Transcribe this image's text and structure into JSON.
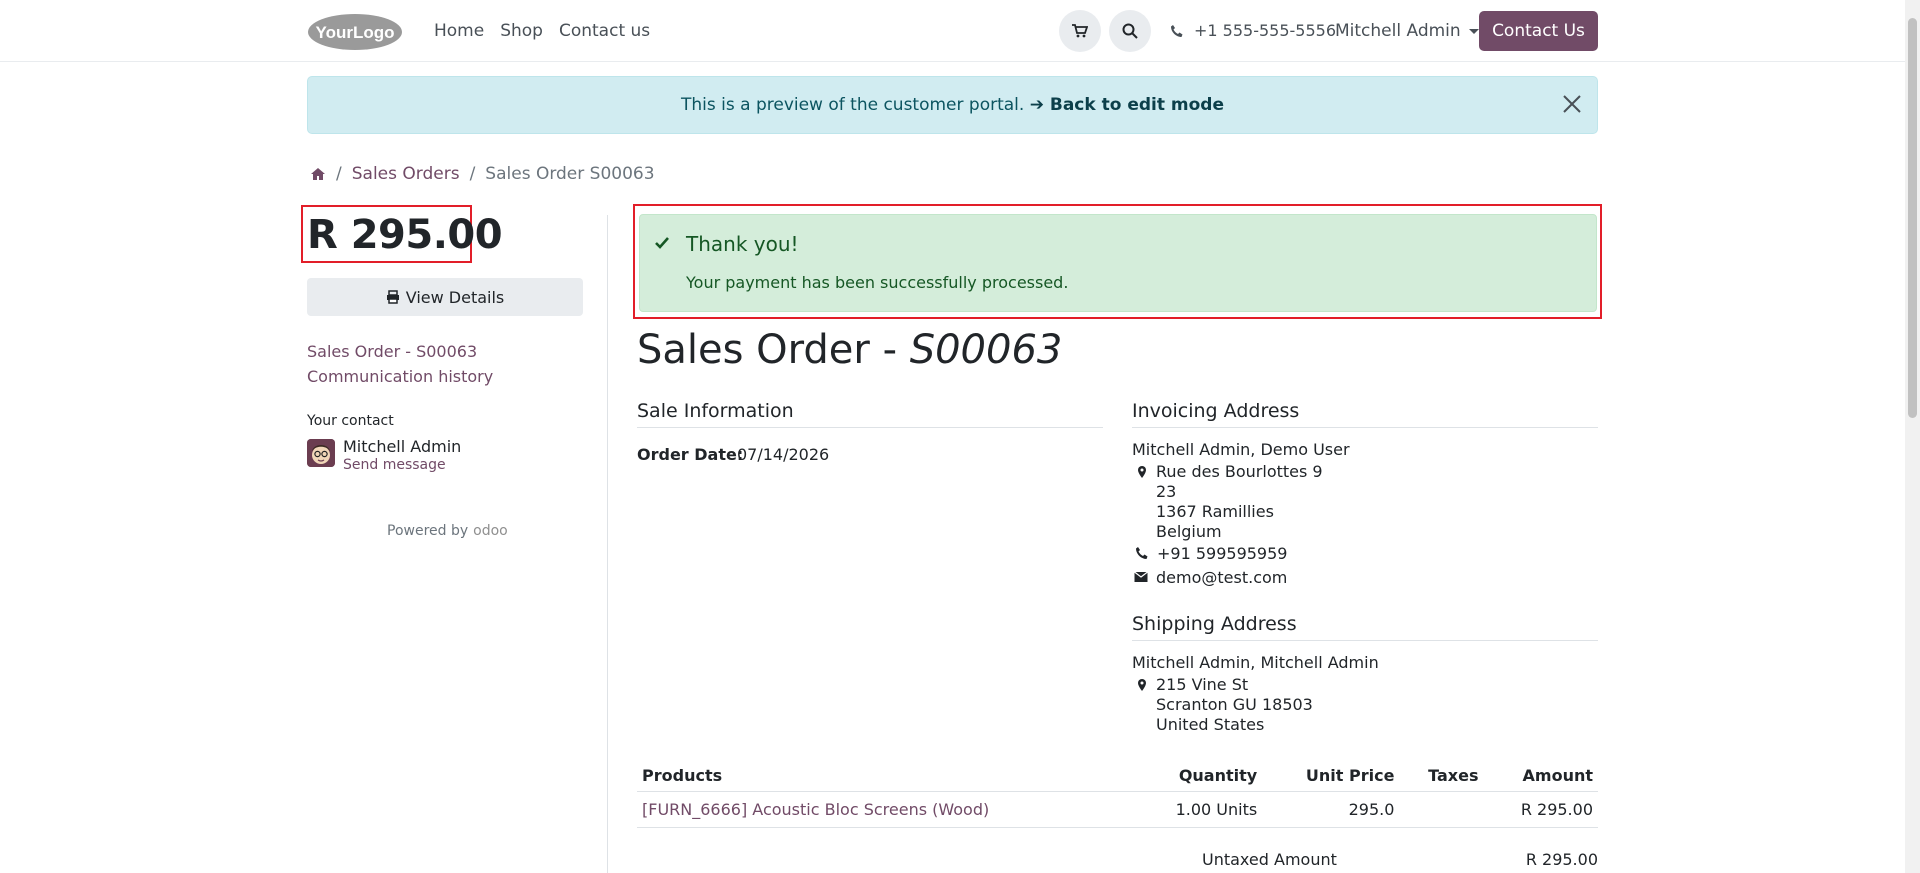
{
  "header": {
    "logo_text": "YourLogo",
    "nav": [
      "Home",
      "Shop",
      "Contact us"
    ],
    "phone": "+1 555-555-5556",
    "user": "Mitchell Admin",
    "contact_button": "Contact Us"
  },
  "preview_alert": {
    "text": "This is a preview of the customer portal.",
    "link": "➔ Back to edit mode"
  },
  "breadcrumb": {
    "parent": "Sales Orders",
    "current": "Sales Order S00063"
  },
  "sidebar": {
    "total": "R 295.00",
    "view_details": "View Details",
    "links": [
      "Sales Order - S00063",
      "Communication history"
    ],
    "your_contact_label": "Your contact",
    "contact_name": "Mitchell Admin",
    "send_message": "Send message",
    "powered_by": "Powered by",
    "odoo": "odoo"
  },
  "success": {
    "title": "Thank you!",
    "message": "Your payment has been successfully processed."
  },
  "order": {
    "title_prefix": "Sales Order - ",
    "title_ref": "S00063",
    "sale_info_title": "Sale Information",
    "order_date_label": "Order Date:",
    "order_date": "07/14/2026",
    "invoicing": {
      "title": "Invoicing Address",
      "name": "Mitchell Admin, Demo User",
      "street": "Rue des Bourlottes 9",
      "street2": "23",
      "city": "1367 Ramillies",
      "country": "Belgium",
      "phone": "+91 599595959",
      "email": "demo@test.com"
    },
    "shipping": {
      "title": "Shipping Address",
      "name": "Mitchell Admin, Mitchell Admin",
      "street": "215 Vine St",
      "city": "Scranton GU 18503",
      "country": "United States"
    }
  },
  "products": {
    "headers": [
      "Products",
      "Quantity",
      "Unit Price",
      "Taxes",
      "Amount"
    ],
    "rows": [
      {
        "name": "[FURN_6666] Acoustic Bloc Screens (Wood)",
        "quantity": "1.00 Units",
        "unit_price": "295.0",
        "taxes": "",
        "amount": "R 295.00"
      }
    ],
    "untaxed_label": "Untaxed Amount",
    "untaxed_value": "R 295.00"
  },
  "colors": {
    "brand": "#714B67",
    "success_bg": "#d4edda",
    "info_bg": "#d1ecf1",
    "highlight": "#e21e29"
  }
}
